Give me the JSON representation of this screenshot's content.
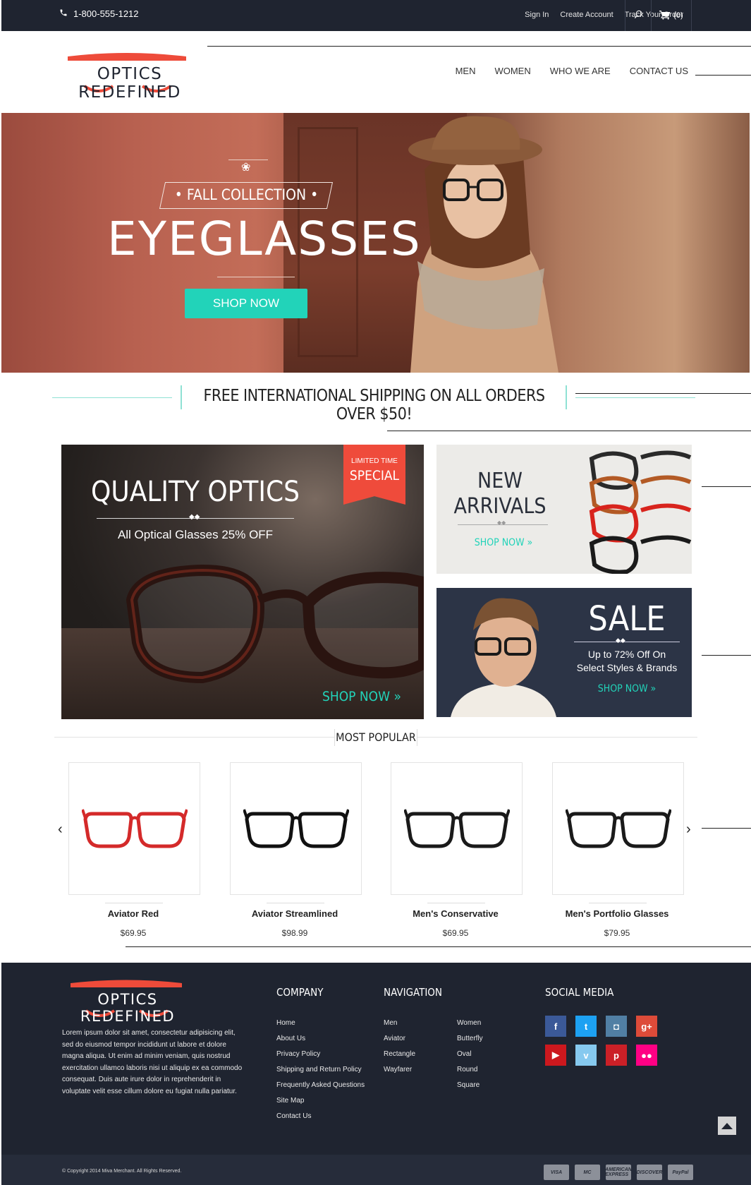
{
  "topbar": {
    "phone": "1-800-555-1212",
    "sign_in": "Sign In",
    "create_account": "Create Account",
    "track_order": "Track Your Order",
    "cart_count": "(0)"
  },
  "brand": {
    "name": "OPTICS REDEFINED"
  },
  "nav": {
    "items": [
      "MEN",
      "WOMEN",
      "WHO WE ARE",
      "CONTACT US"
    ]
  },
  "hero": {
    "kicker": "• FALL COLLECTION •",
    "title": "EYEGLASSES",
    "button": "SHOP NOW"
  },
  "shipping_banner": "FREE INTERNATIONAL SHIPPING ON ALL ORDERS OVER $50!",
  "promo_main": {
    "ribbon_top": "LIMITED TIME",
    "ribbon_bottom": "SPECIAL",
    "title": "QUALITY OPTICS",
    "subtitle": "All Optical Glasses 25% OFF",
    "cta": "SHOP NOW »"
  },
  "promo_arrivals": {
    "title_line1": "NEW",
    "title_line2": "ARRIVALS",
    "cta": "SHOP NOW »"
  },
  "promo_sale": {
    "title": "SALE",
    "line1": "Up to 72% Off On",
    "line2": "Select Styles & Brands",
    "cta": "SHOP NOW »"
  },
  "most_popular": {
    "heading": "MOST POPULAR",
    "products": [
      {
        "name": "Aviator Red",
        "price": "$69.95",
        "frame_color": "#d42a2a"
      },
      {
        "name": "Aviator Streamlined",
        "price": "$98.99",
        "frame_color": "#111111"
      },
      {
        "name": "Men's Conservative",
        "price": "$69.95",
        "frame_color": "#1a1a1a"
      },
      {
        "name": "Men's Portfolio Glasses",
        "price": "$79.95",
        "frame_color": "#1a1a1a"
      }
    ]
  },
  "footer": {
    "about": "Lorem ipsum dolor sit amet, consectetur adipisicing elit, sed do eiusmod tempor incididunt ut labore et dolore magna aliqua. Ut enim ad minim veniam, quis nostrud exercitation ullamco laboris nisi ut aliquip ex ea commodo consequat. Duis aute irure dolor in reprehenderit in voluptate velit esse cillum dolore eu fugiat nulla pariatur.",
    "company_title": "COMPANY",
    "company_links": [
      "Home",
      "About Us",
      "Privacy Policy",
      "Shipping and Return Policy",
      "Frequently Asked Questions",
      "Site Map",
      "Contact Us"
    ],
    "navigation_title": "NAVIGATION",
    "navigation_col1": [
      "Men",
      "Aviator",
      "Rectangle",
      "Wayfarer"
    ],
    "navigation_col2": [
      "Women",
      "Butterfly",
      "Oval",
      "Round",
      "Square"
    ],
    "social_title": "SOCIAL MEDIA",
    "social": [
      {
        "name": "facebook",
        "glyph": "f",
        "color": "#3b5998"
      },
      {
        "name": "twitter",
        "glyph": "t",
        "color": "#1da1f2"
      },
      {
        "name": "instagram",
        "glyph": "◘",
        "color": "#517fa4"
      },
      {
        "name": "google-plus",
        "glyph": "g+",
        "color": "#dd4b39"
      },
      {
        "name": "youtube",
        "glyph": "▶",
        "color": "#cc181e"
      },
      {
        "name": "vimeo",
        "glyph": "v",
        "color": "#86c9ef"
      },
      {
        "name": "pinterest",
        "glyph": "p",
        "color": "#cb2027"
      },
      {
        "name": "flickr",
        "glyph": "●●",
        "color": "#ff0084"
      }
    ],
    "copyright": "© Copyright 2014 Miva Merchant. All Rights Reserved.",
    "payments": [
      "VISA",
      "MC",
      "AMERICAN EXPRESS",
      "DISCOVER",
      "PayPal"
    ]
  },
  "colors": {
    "accent": "#22d3b9",
    "dark": "#1f2430",
    "brand_red": "#ee4b3a",
    "ribbon": "#ef4b3b"
  }
}
